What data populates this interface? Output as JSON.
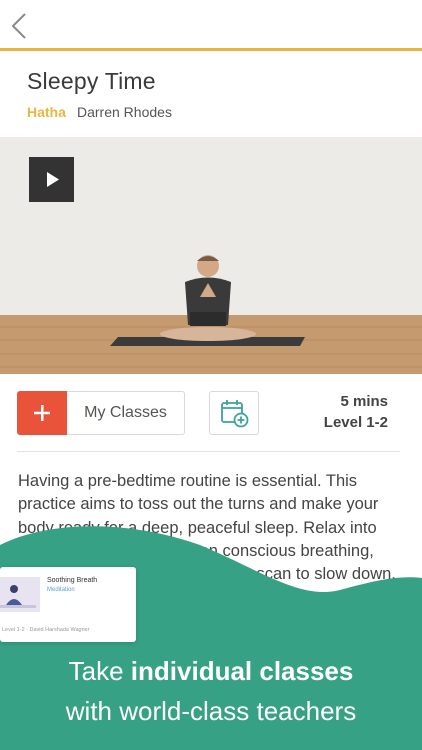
{
  "header": {
    "back_icon": "chevron-left-icon"
  },
  "class": {
    "title": "Sleepy Time",
    "style": "Hatha",
    "teacher": "Darren Rhodes",
    "duration": "5 mins",
    "level": "Level 1-2",
    "description": "Having a pre-bedtime routine is essential. This practice aims to toss out the turns and make your body ready for a deep, peaceful sleep. Relax into the practice with a focus on conscious breathing, gentle stretching and a full-body scan to slow down."
  },
  "actions": {
    "add_icon": "plus-icon",
    "my_classes_label": "My Classes",
    "calendar_icon": "calendar-add-icon"
  },
  "video": {
    "play_icon": "play-icon"
  },
  "promo_card": {
    "title": "Soothing Breath",
    "subtitle": "Meditation",
    "meta": "Level 1-2 · David Harshada Wagner"
  },
  "tagline": {
    "line1_prefix": "Take ",
    "line1_bold": "individual classes",
    "line2": "with world-class teachers"
  },
  "colors": {
    "accent": "#e9b63f",
    "add_button": "#e9533a",
    "wave": "#36a184",
    "calendar": "#3aa39a"
  }
}
